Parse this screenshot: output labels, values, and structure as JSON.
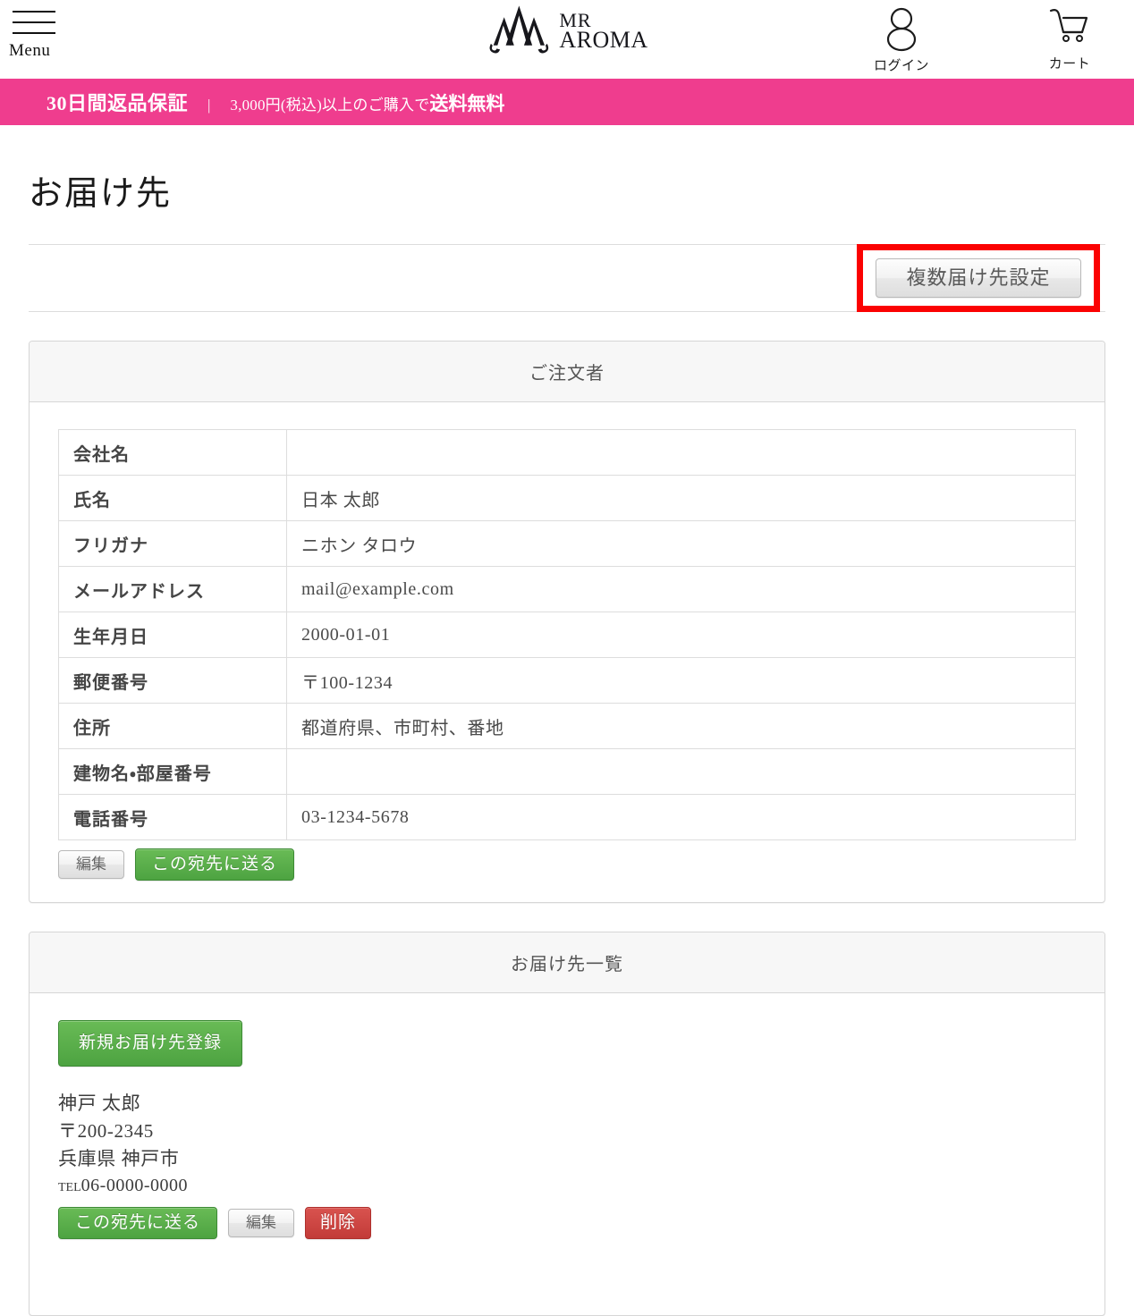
{
  "header": {
    "menu_label": "Menu",
    "brand_line1": "MR",
    "brand_line2": "AROMA",
    "login_label": "ログイン",
    "cart_label": "カート"
  },
  "promo": {
    "guarantee": "30日間返品保証",
    "separator": "|",
    "shipping_prefix": "3,000円(税込)以上のご購入で",
    "shipping_emphasis": "送料無料",
    "background_color": "#ef3d8e"
  },
  "page": {
    "title": "お届け先",
    "multi_ship_button": "複数届け先設定",
    "highlight_color": "#fb0202"
  },
  "orderer_panel": {
    "heading": "ご注文者",
    "rows": [
      {
        "label": "会社名",
        "value": ""
      },
      {
        "label": "氏名",
        "value": "日本 太郎"
      },
      {
        "label": "フリガナ",
        "value": "ニホン タロウ"
      },
      {
        "label": "メールアドレス",
        "value": "mail@example.com"
      },
      {
        "label": "生年月日",
        "value": "2000-01-01"
      },
      {
        "label": "郵便番号",
        "value": "〒100-1234"
      },
      {
        "label": "住所",
        "value": "都道府県、市町村、番地"
      },
      {
        "label": "建物名・部屋番号",
        "value": ""
      },
      {
        "label": "電話番号",
        "value": "03-1234-5678"
      }
    ],
    "edit_button": "編集",
    "send_button": "この宛先に送る"
  },
  "destination_panel": {
    "heading": "お届け先一覧",
    "new_button": "新規お届け先登録",
    "entries": [
      {
        "name": "神戸 太郎",
        "postal_code": "〒200-2345",
        "address": "兵庫県 神戸市",
        "tel_label": "Tel",
        "tel_number": "06-0000-0000",
        "send_button": "この宛先に送る",
        "edit_button": "編集",
        "delete_button": "削除"
      }
    ]
  },
  "colors": {
    "green_button": "#4da341",
    "red_button": "#c23b38",
    "gray_button": "#e8e8e8"
  }
}
